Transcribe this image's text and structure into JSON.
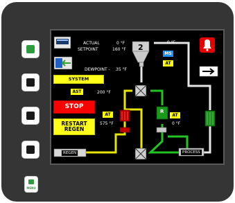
{
  "panel": {
    "side_buttons": [
      "side-button-1",
      "side-button-2",
      "side-button-3",
      "side-button-4"
    ],
    "menu_label": "MENU"
  },
  "screen": {
    "actual_label": "ACTUAL",
    "actual_value": "0 °F",
    "setpoint_label": "SETPOINT",
    "setpoint_value": "160 °F",
    "dewpoint_label": "DEWPOINT -",
    "dewpoint_value": "35 °F",
    "top_right_temp": "0 °F",
    "hopper_number": "2",
    "ms_tag": "MS",
    "at_tag_top": "AT",
    "system_shutdown": "SYSTEM SHUTDOWN",
    "ast_tag": "AST",
    "ast_value": "200 °F",
    "stop": "STOP",
    "restart_regen_line1": "RESTART",
    "restart_regen_line2": "REGEN",
    "at_tag_left": "AT",
    "left_heater_temp": "575 °F",
    "at_tag_right": "AT",
    "right_heater_temp": "0 °F",
    "heater_r": "R",
    "regen_label": "REGEN",
    "process_label": "PROCESS"
  },
  "colors": {
    "accent_green": "#2e9b3e",
    "pipe_white": "#e6e6e6",
    "pipe_yellow": "#e6e600",
    "pipe_green": "#22c322",
    "alarm_red": "#e60000"
  }
}
